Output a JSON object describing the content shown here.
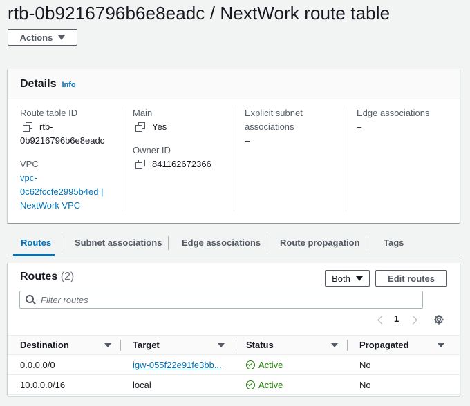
{
  "page": {
    "title": "rtb-0b9216796b6e8eadc / NextWork route table",
    "actions_label": "Actions"
  },
  "details": {
    "heading": "Details",
    "info_label": "Info",
    "route_table_id_label": "Route table ID",
    "route_table_id_line1": "rtb-",
    "route_table_id_line2": "0b9216796b6e8eadc",
    "vpc_label": "VPC",
    "vpc_line1": "vpc-",
    "vpc_line2": "0c62fccfe2995b4ed |",
    "vpc_line3": "NextWork VPC",
    "main_label": "Main",
    "main_value": "Yes",
    "owner_id_label": "Owner ID",
    "owner_id_value": "841162672366",
    "explicit_label_line1": "Explicit subnet",
    "explicit_label_line2": "associations",
    "explicit_value": "–",
    "edge_label": "Edge associations",
    "edge_value": "–"
  },
  "tabs": [
    {
      "label": "Routes",
      "active": true
    },
    {
      "label": "Subnet associations",
      "active": false
    },
    {
      "label": "Edge associations",
      "active": false
    },
    {
      "label": "Route propagation",
      "active": false
    },
    {
      "label": "Tags",
      "active": false
    }
  ],
  "routes": {
    "heading": "Routes",
    "count": "(2)",
    "filter_selected": "Both",
    "edit_label": "Edit routes",
    "search_placeholder": "Filter routes",
    "page_number": "1",
    "columns": [
      "Destination",
      "Target",
      "Status",
      "Propagated"
    ],
    "rows": [
      {
        "destination": "0.0.0.0/0",
        "target": "igw-055f22e91fe3bb...",
        "target_is_link": true,
        "status": "Active",
        "propagated": "No"
      },
      {
        "destination": "10.0.0.0/16",
        "target": "local",
        "target_is_link": false,
        "status": "Active",
        "propagated": "No"
      }
    ]
  },
  "colors": {
    "link": "#0073bb",
    "success": "#1d8102",
    "background": "#f2f3f3"
  },
  "icons": [
    "copy-icon",
    "search-icon",
    "settings-gear-icon",
    "chevron-left-icon",
    "chevron-right-icon",
    "sort-caret-icon",
    "status-success-icon",
    "dropdown-caret-icon"
  ]
}
